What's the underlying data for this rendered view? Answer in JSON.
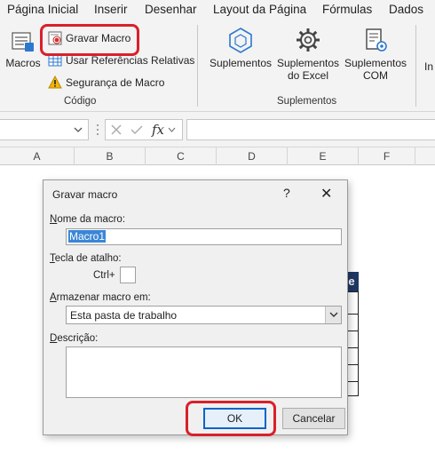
{
  "menu_tabs": [
    "Página Inicial",
    "Inserir",
    "Desenhar",
    "Layout da Página",
    "Fórmulas",
    "Dados"
  ],
  "ribbon": {
    "codigo": {
      "macros_label": "Macros",
      "gravar_macro_label": "Gravar Macro",
      "referencias_label": "Usar Referências Relativas",
      "seguranca_label": "Segurança de Macro",
      "group_label": "Código"
    },
    "suplementos": {
      "suplementos_label": "Suplementos",
      "excel_line1": "Suplementos",
      "excel_line2": "do Excel",
      "com_line1": "Suplementos",
      "com_line2": "COM",
      "group_label": "Suplementos"
    },
    "partial_label": "In"
  },
  "formula_bar": {
    "name_box_value": "",
    "fx_label": "fx",
    "formula_value": ""
  },
  "columns": [
    "A",
    "B",
    "C",
    "D",
    "E",
    "F"
  ],
  "sheet": {
    "table_header_fragment": "e"
  },
  "dialog": {
    "title": "Gravar macro",
    "help": "?",
    "close": "✕",
    "nome_label_u": "N",
    "nome_label_rest": "ome da macro:",
    "nome_value": "Macro1",
    "tecla_label_u": "T",
    "tecla_label_rest": "ecla de atalho:",
    "ctrl_prefix": "Ctrl+",
    "shortcut_value": "",
    "armazenar_label_u": "A",
    "armazenar_label_rest": "rmazenar macro em:",
    "armazenar_value": "Esta pasta de trabalho",
    "descricao_label_u": "D",
    "descricao_label_rest": "escrição:",
    "descricao_value": "",
    "ok_label": "OK",
    "cancel_label": "Cancelar"
  },
  "colors": {
    "highlight": "#d9202a",
    "table_header": "#1f3864",
    "selection": "#3a86d6",
    "ok_border": "#0a64c8"
  }
}
